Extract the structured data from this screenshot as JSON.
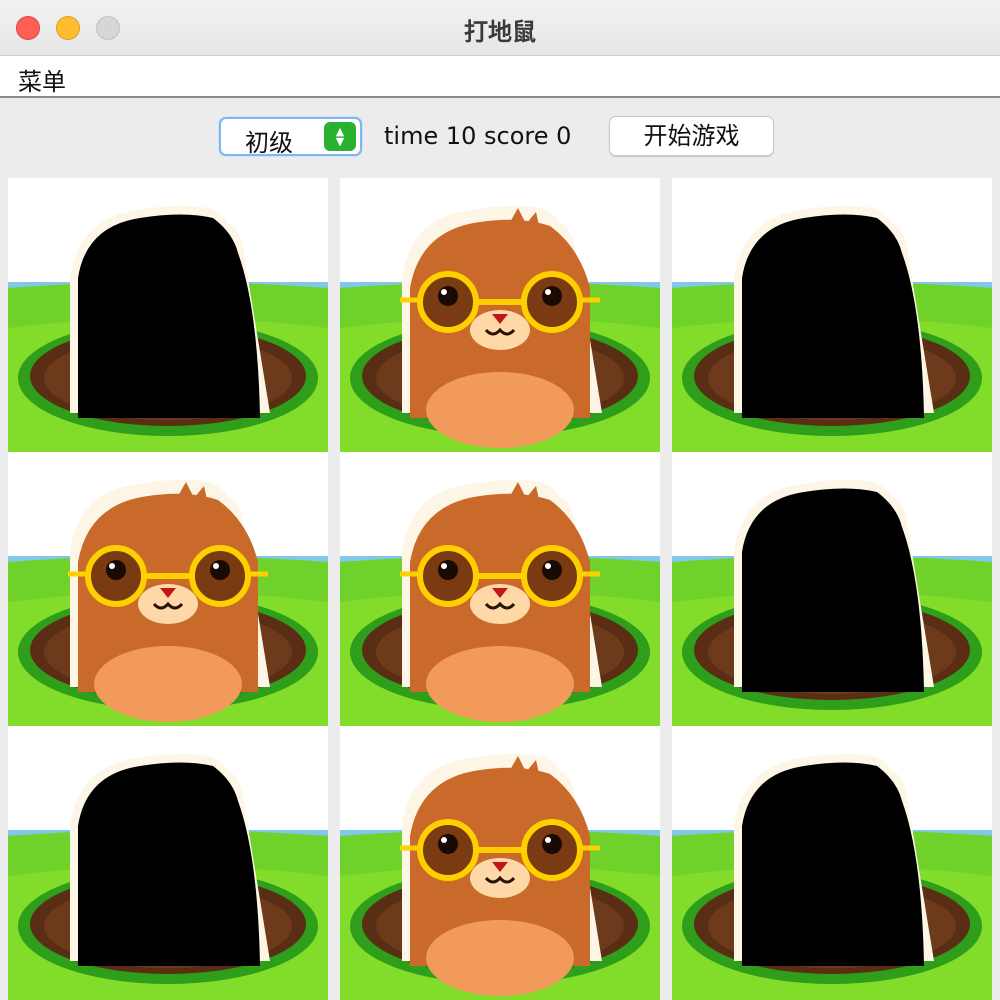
{
  "window": {
    "title": "打地鼠"
  },
  "menu": {
    "items": [
      "菜单"
    ]
  },
  "toolbar": {
    "level_select": {
      "selected": "初级"
    },
    "status_text": "time 10 score 0",
    "time": 10,
    "score": 0,
    "start_button": "开始游戏"
  },
  "grid": {
    "rows": 3,
    "cols": 3,
    "cells": [
      {
        "state": "hidden"
      },
      {
        "state": "mole"
      },
      {
        "state": "hidden"
      },
      {
        "state": "mole"
      },
      {
        "state": "mole"
      },
      {
        "state": "hidden"
      },
      {
        "state": "hidden"
      },
      {
        "state": "mole"
      },
      {
        "state": "hidden"
      }
    ]
  },
  "colors": {
    "close": "#fe5f57",
    "minimize": "#febc2e",
    "maximize": "#d6d6d6",
    "select_arrow": "#29b12f",
    "grass": "#6fd12a",
    "hole": "#6e3a1c",
    "mole": "#c9692a",
    "glasses": "#ffd000"
  }
}
